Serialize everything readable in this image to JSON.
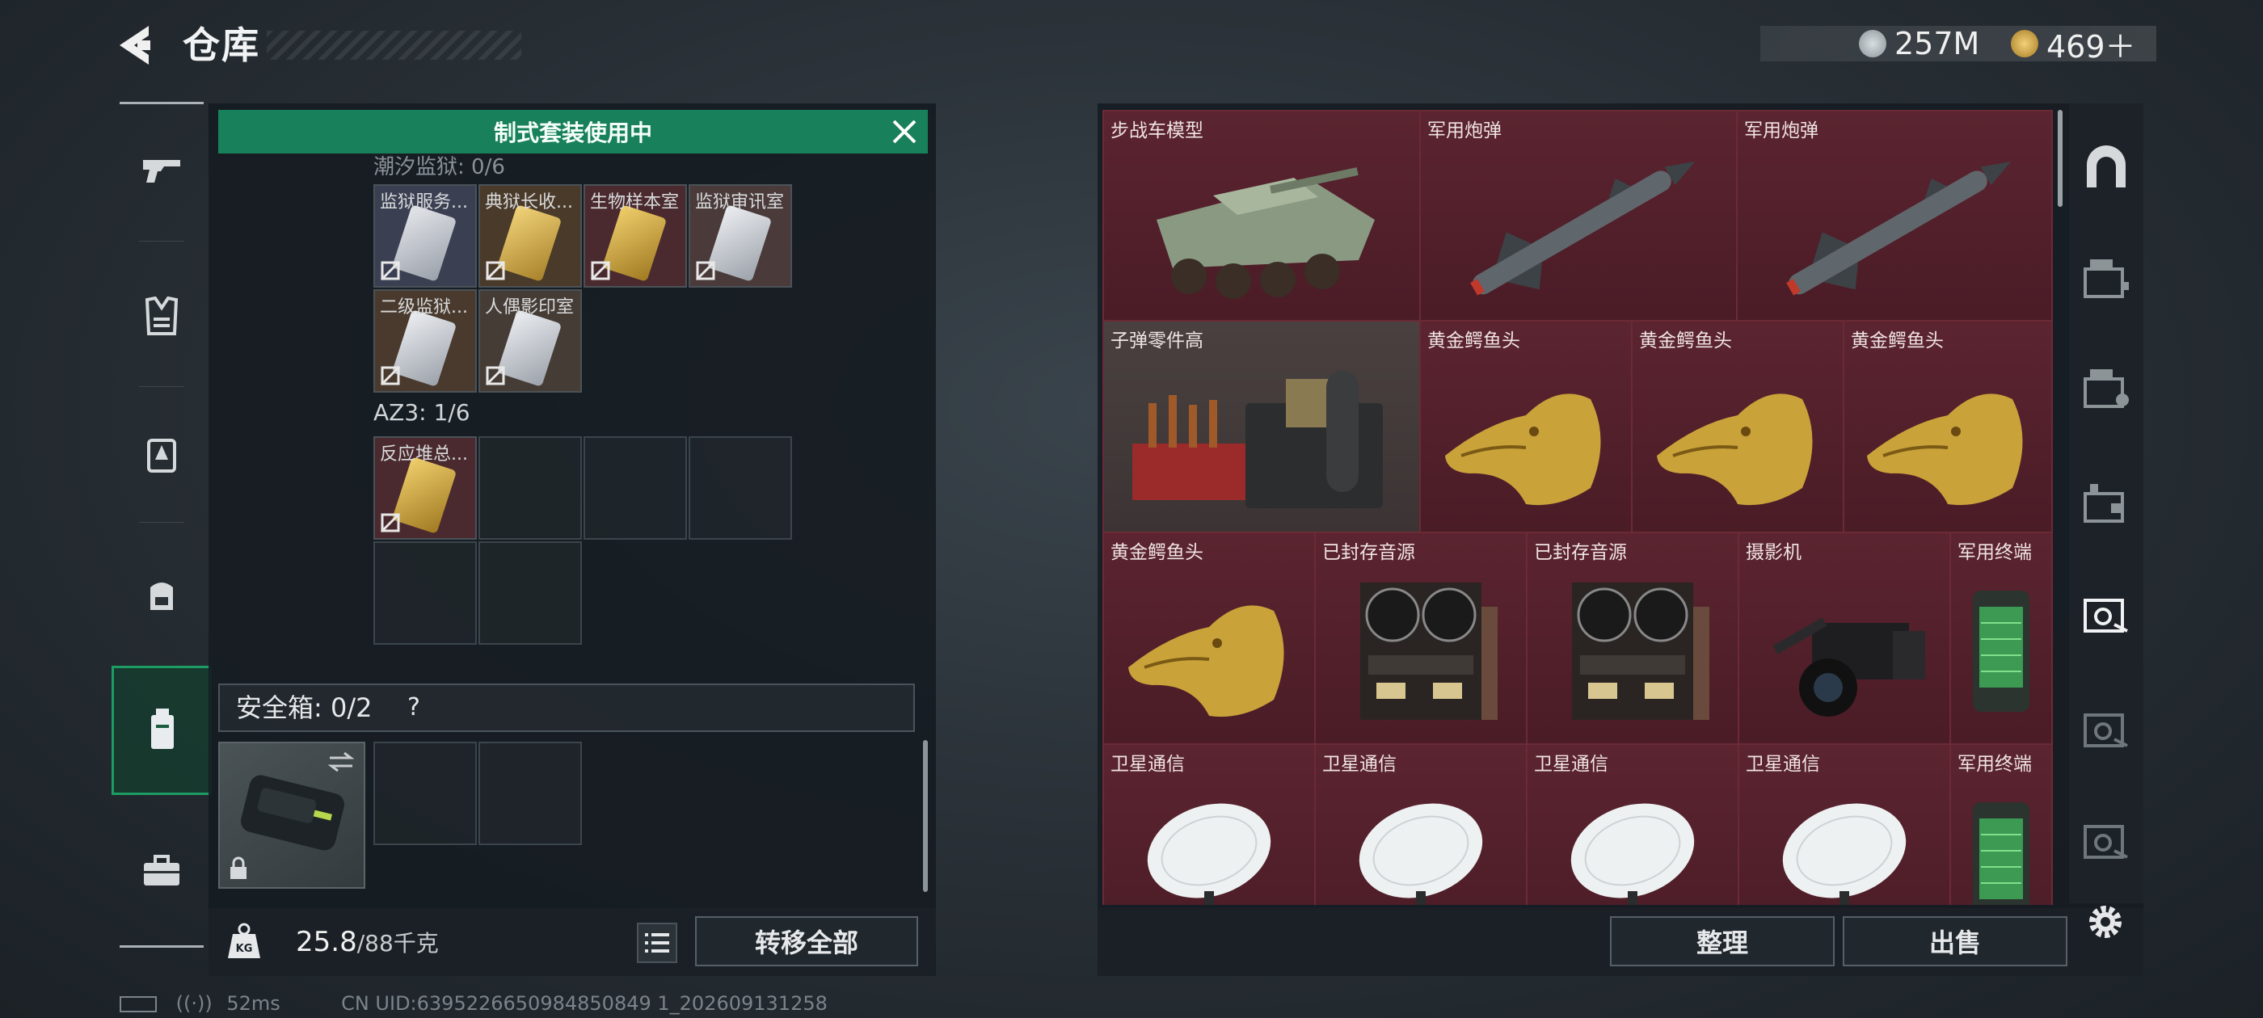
{
  "header": {
    "title": "仓库"
  },
  "currency": {
    "silver": "257M",
    "gold": "469＋"
  },
  "left_panel": {
    "kit_banner": "制式套装使用中",
    "partial_label": "潮汐监狱: 0/6",
    "set1_items": [
      {
        "name": "监狱服务..."
      },
      {
        "name": "典狱长收..."
      },
      {
        "name": "生物样本室"
      },
      {
        "name": "监狱审讯室"
      },
      {
        "name": "二级监狱..."
      },
      {
        "name": "人偶影印室"
      }
    ],
    "az3_label": "AZ3: 1/6",
    "az3_items": [
      {
        "name": "反应堆总..."
      }
    ],
    "safe_box_label": "安全箱: 0/2",
    "safe_help": "?",
    "weight_value": "25.8",
    "weight_limit": "/88千克",
    "transfer_all": "转移全部"
  },
  "grid_items": [
    {
      "name": "步战车模型"
    },
    {
      "name": "军用炮弹"
    },
    {
      "name": "军用炮弹"
    },
    {
      "name": "子弹零件高"
    },
    {
      "name": "黄金鳄鱼头"
    },
    {
      "name": "黄金鳄鱼头"
    },
    {
      "name": "黄金鳄鱼头"
    },
    {
      "name": "黄金鳄鱼头"
    },
    {
      "name": "已封存音源"
    },
    {
      "name": "已封存音源"
    },
    {
      "name": "摄影机"
    },
    {
      "name": "军用终端"
    },
    {
      "name": "卫星通信"
    },
    {
      "name": "卫星通信"
    },
    {
      "name": "卫星通信"
    },
    {
      "name": "卫星通信"
    },
    {
      "name": "军用终端"
    }
  ],
  "bottom_right": {
    "sort": "整理",
    "sell": "出售"
  },
  "status_bar": {
    "ping": "52ms",
    "uid": "CN UID:6395226650984850849 1_202609131258"
  },
  "colors": {
    "kit_green": "#18805a",
    "grid_bg": "#4a1c26",
    "active_tab": "#1d9c63"
  }
}
